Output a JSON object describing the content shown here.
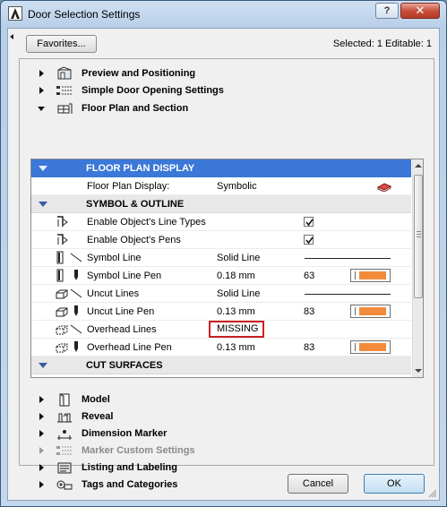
{
  "window": {
    "title": "Door Selection Settings",
    "help_label": "?",
    "close_label": "✕"
  },
  "toolbar": {
    "favorites_label": "Favorites...",
    "selection_info": "Selected: 1 Editable: 1"
  },
  "sections_top": [
    {
      "label": "Preview and Positioning",
      "icon": "preview-icon",
      "expanded": false
    },
    {
      "label": "Simple Door Opening Settings",
      "icon": "door-opening-icon",
      "expanded": false
    },
    {
      "label": "Floor Plan and Section",
      "icon": "floor-plan-icon",
      "expanded": true
    }
  ],
  "floor_plan_panel": {
    "header": "FLOOR PLAN DISPLAY",
    "display_label": "Floor Plan Display:",
    "display_value": "Symbolic",
    "symbol_group": "SYMBOL & OUTLINE",
    "rows": {
      "line_types": {
        "name": "Enable Object's Line Types",
        "checked": true
      },
      "pens": {
        "name": "Enable Object's Pens",
        "checked": true
      },
      "symbol_line": {
        "name": "Symbol Line",
        "value": "Solid Line"
      },
      "symbol_pen": {
        "name": "Symbol Line Pen",
        "value": "0.18 mm",
        "pen": "63",
        "color": "#f28b3c"
      },
      "uncut_lines": {
        "name": "Uncut Lines",
        "value": "Solid Line"
      },
      "uncut_pen": {
        "name": "Uncut Line Pen",
        "value": "0.13 mm",
        "pen": "83",
        "color": "#f28b3c"
      },
      "overhead_lines": {
        "name": "Overhead Lines",
        "value": "MISSING"
      },
      "overhead_pen": {
        "name": "Overhead Line Pen",
        "value": "0.13 mm",
        "pen": "83",
        "color": "#f28b3c"
      }
    },
    "cut_group": "CUT SURFACES"
  },
  "sections_bottom": [
    {
      "label": "Model",
      "icon": "model-icon",
      "enabled": true
    },
    {
      "label": "Reveal",
      "icon": "reveal-icon",
      "enabled": true
    },
    {
      "label": "Dimension Marker",
      "icon": "dimension-marker-icon",
      "enabled": true
    },
    {
      "label": "Marker Custom Settings",
      "icon": "marker-custom-icon",
      "enabled": false
    },
    {
      "label": "Listing and Labeling",
      "icon": "listing-icon",
      "enabled": true
    },
    {
      "label": "Tags and Categories",
      "icon": "tags-icon",
      "enabled": true
    }
  ],
  "footer": {
    "cancel_label": "Cancel",
    "ok_label": "OK"
  },
  "colors": {
    "selection_blue": "#3b78d8",
    "missing_red": "#c8201f",
    "pen_orange": "#f28b3c"
  }
}
